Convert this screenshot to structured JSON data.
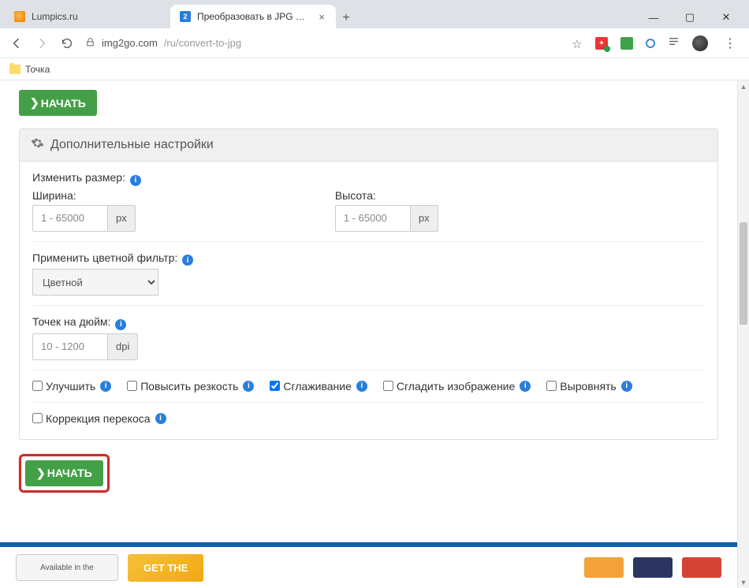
{
  "window": {
    "tab1_label": "Lumpics.ru",
    "tab2_label": "Преобразовать в JPG — Конве…",
    "tab2_badge": "2"
  },
  "toolbar": {
    "host": "img2go.com",
    "path": "/ru/convert-to-jpg"
  },
  "bookmarks": {
    "item1": "Точка"
  },
  "buttons": {
    "start": "НАЧАТЬ"
  },
  "panel": {
    "title": "Дополнительные настройки",
    "resize_label": "Изменить размер:",
    "width_label": "Ширина:",
    "height_label": "Высота:",
    "size_placeholder": "1 - 65000",
    "px_unit": "px",
    "filter_label": "Применить цветной фильтр:",
    "filter_value": "Цветной",
    "dpi_label": "Точек на дюйм:",
    "dpi_placeholder": "10 - 1200",
    "dpi_unit": "dpi",
    "checks": {
      "enhance": "Улучшить",
      "sharpen": "Повысить резкость",
      "antialias": "Сглаживание",
      "smooth": "Сгладить изображение",
      "align": "Выровнять",
      "deskew": "Коррекция перекоса"
    }
  },
  "footer": {
    "store": "Available in the",
    "cta": "GET THE"
  }
}
